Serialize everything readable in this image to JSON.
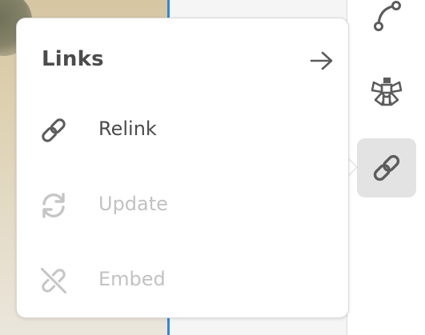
{
  "popover": {
    "title": "Links",
    "header_arrow_icon": "arrow-right-icon",
    "items": [
      {
        "label": "Relink",
        "icon": "link-icon",
        "enabled": true
      },
      {
        "label": "Update",
        "icon": "refresh-icon",
        "enabled": false
      },
      {
        "label": "Embed",
        "icon": "unlink-icon",
        "enabled": false
      }
    ]
  },
  "tool_rail": {
    "items": [
      {
        "icon": "path-anchor-icon",
        "active": false
      },
      {
        "icon": "component-icon",
        "active": false
      },
      {
        "icon": "link-icon",
        "active": true
      }
    ]
  },
  "colors": {
    "selection_blue": "#2f86e6",
    "enabled_text": "#4b4b4b",
    "disabled_text": "#c2c2c2",
    "active_rail_bg": "#e3e3e3"
  }
}
